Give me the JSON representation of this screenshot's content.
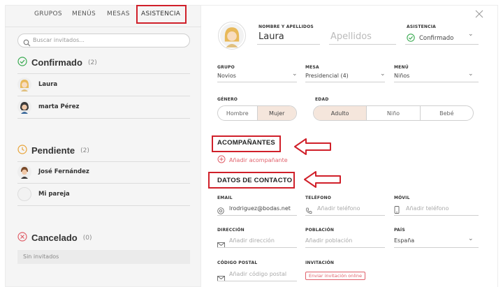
{
  "tabs": [
    "GRUPOS",
    "MENÚS",
    "MESAS",
    "ASISTENCIA"
  ],
  "search": {
    "placeholder": "Buscar invitados..."
  },
  "groups": [
    {
      "title": "Confirmado",
      "count": "(2)",
      "color": "#3bab52",
      "guests": [
        "Laura",
        "marta Pérez"
      ]
    },
    {
      "title": "Pendiente",
      "count": "(2)",
      "color": "#e8a43a",
      "guests": [
        "José Fernández",
        "Mi pareja"
      ]
    },
    {
      "title": "Cancelado",
      "count": "(0)",
      "color": "#e0606a",
      "empty": "Sin invitados"
    }
  ],
  "form": {
    "name_label": "NOMBRE Y APELLIDOS",
    "first_name": "Laura",
    "last_name_placeholder": "Apellidos",
    "attendance_label": "ASISTENCIA",
    "attendance_value": "Confirmado",
    "group_label": "GRUPO",
    "group_value": "Novios",
    "table_label": "MESA",
    "table_value": "Presidencial (4)",
    "menu_label": "MENÚ",
    "menu_value": "Niños",
    "gender_label": "GÉNERO",
    "gender_options": [
      "Hombre",
      "Mujer"
    ],
    "gender_selected": "Mujer",
    "age_label": "EDAD",
    "age_options": [
      "Adulto",
      "Niño",
      "Bebé"
    ],
    "age_selected": "Adulto",
    "companions_title": "ACOMPAÑANTES",
    "add_companion": "Añadir acompañante",
    "contact_title": "DATOS DE CONTACTO",
    "email_label": "EMAIL",
    "email_value": "lrodriguez@bodas.net",
    "phone_label": "TELÉFONO",
    "phone_placeholder": "Añadir teléfono",
    "mobile_label": "MÓVIL",
    "mobile_placeholder": "Añadir teléfono",
    "address_label": "DIRECCIÓN",
    "address_placeholder": "Añadir dirección",
    "city_label": "POBLACIÓN",
    "city_placeholder": "Añadir población",
    "country_label": "PAÍS",
    "country_value": "España",
    "zip_label": "CÓDIGO POSTAL",
    "zip_placeholder": "Añadir código postal",
    "invite_label": "INVITACIÓN",
    "invite_button": "Enviar invitación online"
  },
  "colors": {
    "accent": "#e0606a",
    "highlight": "#d0202a",
    "selected_bg": "#f5e6dc"
  }
}
